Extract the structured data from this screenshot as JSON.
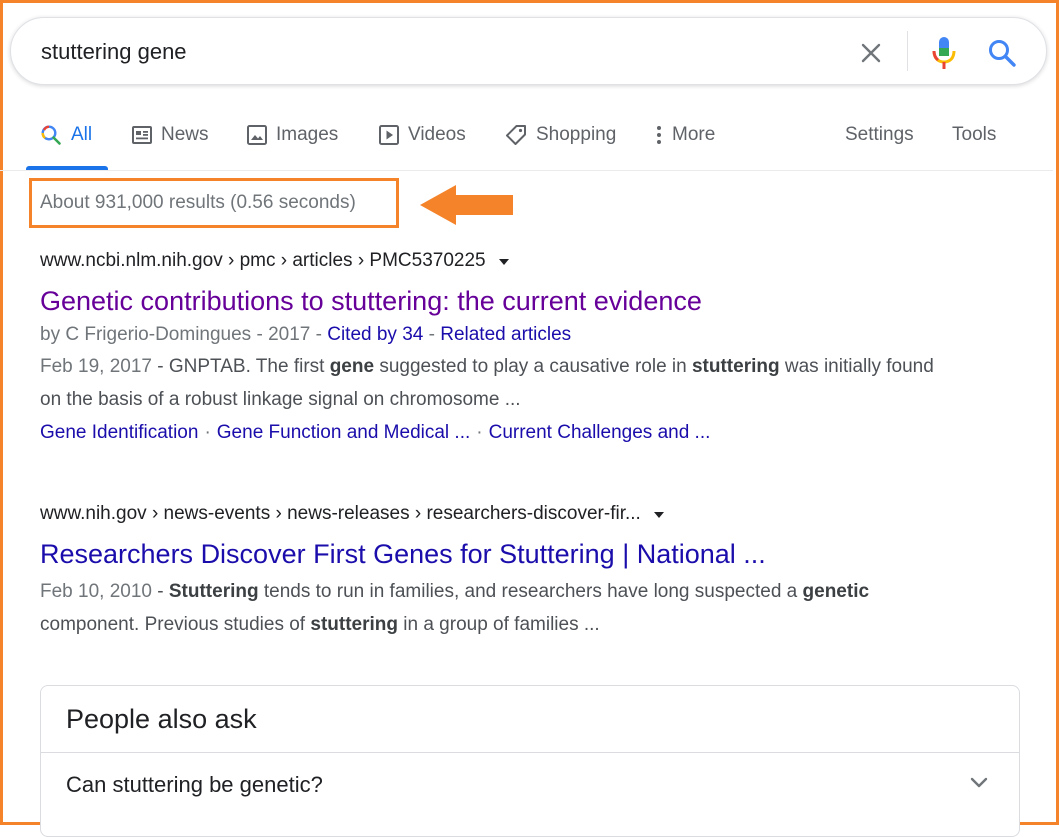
{
  "search": {
    "query": "stuttering gene"
  },
  "tabs": [
    {
      "label": "All",
      "icon": "search-icon",
      "active": true
    },
    {
      "label": "News",
      "icon": "news-icon"
    },
    {
      "label": "Images",
      "icon": "image-icon"
    },
    {
      "label": "Videos",
      "icon": "play-icon"
    },
    {
      "label": "Shopping",
      "icon": "tag-icon"
    },
    {
      "label": "More",
      "icon": "more-vert-icon"
    }
  ],
  "tools": {
    "settings_label": "Settings",
    "tools_label": "Tools"
  },
  "stats": {
    "text": "About 931,000 results (0.56 seconds)"
  },
  "results": [
    {
      "breadcrumb": "www.ncbi.nlm.nih.gov › pmc › articles › PMC5370225",
      "title": "Genetic contributions to stuttering: the current evidence",
      "meta_prefix": "by C Frigerio-Domingues - 2017 - ",
      "cited_by": "Cited by 34",
      "meta_sep": " - ",
      "related": "Related articles",
      "date": "Feb 19, 2017",
      "snippet_parts": [
        " - GNPTAB. The first ",
        "gene",
        " suggested to play a causative role in ",
        "stuttering",
        " was initially found on the basis of a robust linkage signal on chromosome ..."
      ],
      "sitelinks": [
        "Gene Identification",
        "Gene Function and Medical ...",
        "Current Challenges and ..."
      ]
    },
    {
      "breadcrumb": "www.nih.gov › news-events › news-releases › researchers-discover-fir...",
      "title": "Researchers Discover First Genes for Stuttering | National ...",
      "date": "Feb 10, 2010",
      "snippet_parts": [
        " - ",
        "Stuttering",
        " tends to run in families, and researchers have long suspected a ",
        "genetic",
        " component. Previous studies of ",
        "stuttering",
        " in a group of families ..."
      ]
    }
  ],
  "people_also_ask": {
    "title": "People also ask",
    "questions": [
      "Can stuttering be genetic?"
    ]
  },
  "colors": {
    "annotation": "#f5832a",
    "link": "#1a0dab",
    "visited": "#660099",
    "active_tab": "#1a73e8"
  }
}
